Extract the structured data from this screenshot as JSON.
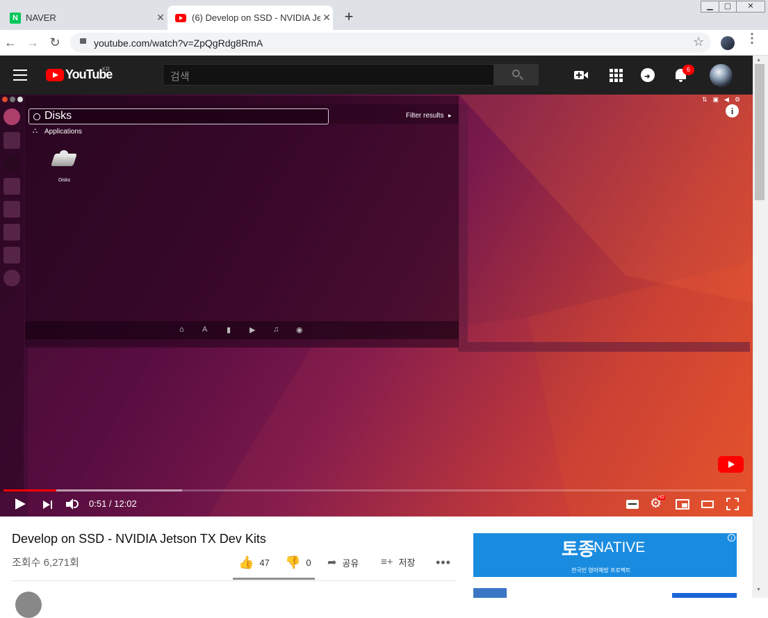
{
  "browser": {
    "tabs": [
      {
        "label": "NAVER",
        "active": false,
        "icon": "naver-icon"
      },
      {
        "label": "(6) Develop on SSD - NVIDIA Je",
        "active": true,
        "icon": "youtube-favicon-icon"
      }
    ],
    "new_tab_label": "+",
    "url": "youtube.com/watch?v=ZpQgRdg8RmA"
  },
  "youtube": {
    "logo_text": "YouTube",
    "region": "KR",
    "search_placeholder": "검색",
    "notification_count": "6"
  },
  "video": {
    "ubuntu": {
      "search_text": "Disks",
      "filter_label": "Filter results",
      "section_label": "Applications",
      "app_label": "Disks"
    },
    "time": "0:51 / 12:02",
    "progress_played": 0.071,
    "progress_buffered": 0.241,
    "title": "Develop on SSD - NVIDIA Jetson TX Dev Kits",
    "views": "조회수 6,271회",
    "likes": "47",
    "dislikes": "0",
    "share_label": "공유",
    "save_label": "저장"
  },
  "ad": {
    "brand": "토종",
    "brand_suffix": "NATIVE",
    "subtitle": "전국민 영어해방 프로젝트"
  },
  "colors": {
    "brand_red": "#ff0000",
    "yt_dark": "#202020",
    "ad_blue": "#1a8ce0"
  }
}
